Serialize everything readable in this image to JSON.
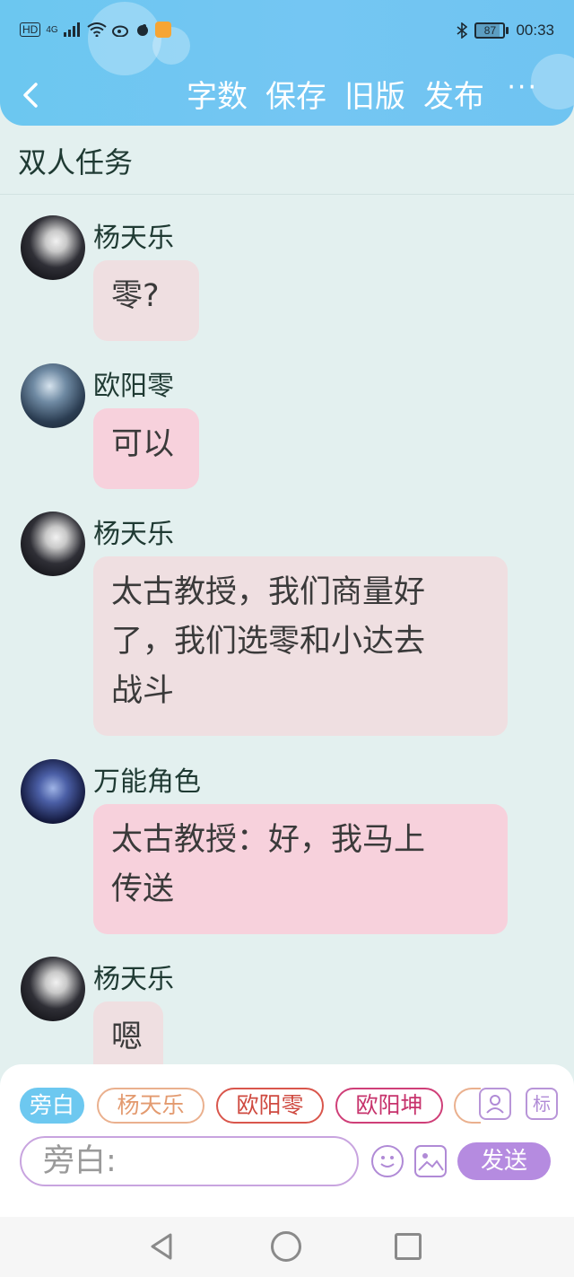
{
  "status_bar": {
    "left_icons": [
      "HD",
      "4G",
      "signal-icon",
      "wifi-icon",
      "weibo-icon",
      "app-icon",
      "notification-icon"
    ],
    "network_label": "HD",
    "network_type": "4G",
    "battery_level": "87",
    "time": "00:33"
  },
  "header": {
    "back_icon": "chevron-left-icon",
    "actions": [
      "字数",
      "保存",
      "旧版",
      "发布"
    ],
    "more_label": "···"
  },
  "chat": {
    "title": "双人任务",
    "messages": [
      {
        "sender": "杨天乐",
        "text": "零?",
        "avatar": "avatar-yang",
        "style": "grey"
      },
      {
        "sender": "欧阳零",
        "text": "可以",
        "avatar": "avatar-ouyang-ling",
        "style": "pink"
      },
      {
        "sender": "杨天乐",
        "text_lines": [
          "太古教授，我们商量好",
          "了，我们选零和小达去",
          "战斗"
        ],
        "avatar": "avatar-yang",
        "style": "grey"
      },
      {
        "sender": "万能角色",
        "text_lines": [
          "太古教授：好，我马上",
          "传送"
        ],
        "avatar": "avatar-universal",
        "style": "pink"
      },
      {
        "sender": "杨天乐",
        "text": "嗯",
        "avatar": "avatar-yang",
        "style": "grey"
      }
    ]
  },
  "composer": {
    "role_chips": [
      "旁白",
      "杨天乐",
      "欧阳零",
      "欧阳坤"
    ],
    "role_icon": "person-icon",
    "tag_label": "标",
    "input_placeholder": "旁白:",
    "emoji_icon": "smile-icon",
    "image_icon": "image-icon",
    "send_label": "发送"
  },
  "colors": {
    "header": "#74c6f3",
    "background": "#e3f0ef",
    "bubble_grey": "#efdfe1",
    "bubble_pink": "#f7d1dc",
    "accent_purple": "#b58be0"
  }
}
